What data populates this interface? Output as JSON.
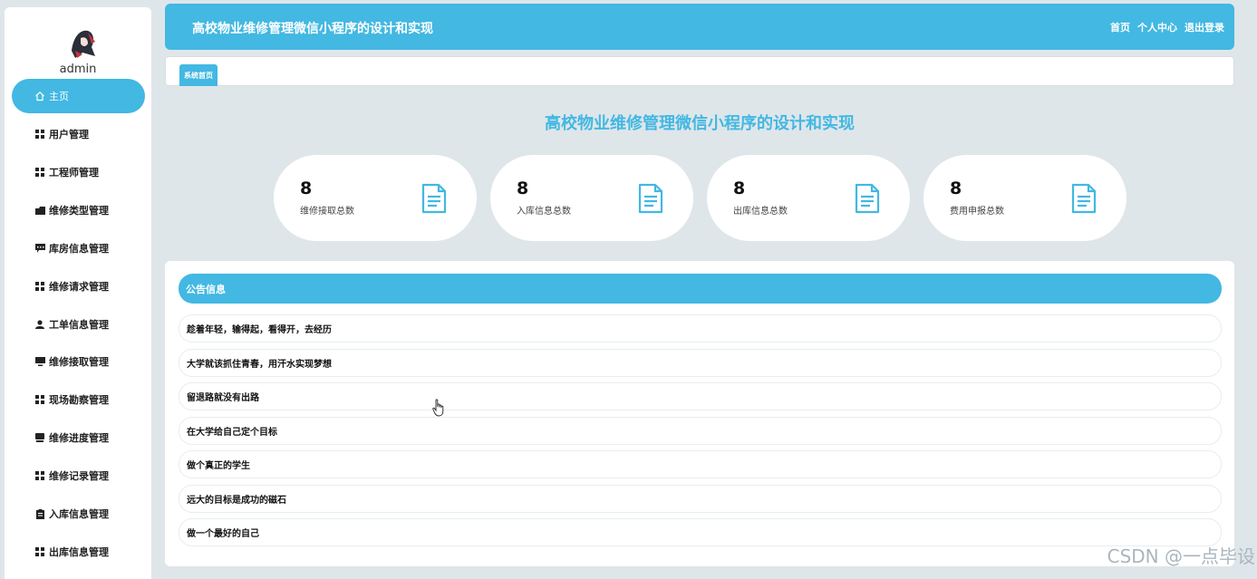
{
  "sidebar": {
    "username": "admin",
    "items": [
      {
        "label": "主页",
        "icon": "home-icon"
      },
      {
        "label": "用户管理",
        "icon": "grid-icon"
      },
      {
        "label": "工程师管理",
        "icon": "grid-icon"
      },
      {
        "label": "维修类型管理",
        "icon": "folder-icon"
      },
      {
        "label": "库房信息管理",
        "icon": "message-icon"
      },
      {
        "label": "维修请求管理",
        "icon": "grid-icon"
      },
      {
        "label": "工单信息管理",
        "icon": "user-icon"
      },
      {
        "label": "维修接取管理",
        "icon": "monitor-icon"
      },
      {
        "label": "现场勘察管理",
        "icon": "grid-icon"
      },
      {
        "label": "维修进度管理",
        "icon": "inbox-icon"
      },
      {
        "label": "维修记录管理",
        "icon": "grid-icon"
      },
      {
        "label": "入库信息管理",
        "icon": "clipboard-icon"
      },
      {
        "label": "出库信息管理",
        "icon": "grid-icon"
      }
    ]
  },
  "header": {
    "title": "高校物业维修管理微信小程序的设计和实现",
    "links": [
      "首页",
      "个人中心",
      "退出登录"
    ]
  },
  "tabs": [
    "系统首页"
  ],
  "main": {
    "title": "高校物业维修管理微信小程序的设计和实现",
    "stats": [
      {
        "value": "8",
        "label": "维修接取总数"
      },
      {
        "value": "8",
        "label": "入库信息总数"
      },
      {
        "value": "8",
        "label": "出库信息总数"
      },
      {
        "value": "8",
        "label": "费用申报总数"
      }
    ]
  },
  "notices": {
    "title": "公告信息",
    "items": [
      "趁着年轻，输得起，看得开，去经历",
      "大学就该抓住青春，用汗水实现梦想",
      "留退路就没有出路",
      "在大学给自己定个目标",
      "做个真正的学生",
      "远大的目标是成功的磁石",
      "做一个最好的自己"
    ]
  },
  "watermark": "CSDN @一点毕设",
  "colors": {
    "accent": "#42b8e2",
    "background": "#dfe6ea"
  }
}
